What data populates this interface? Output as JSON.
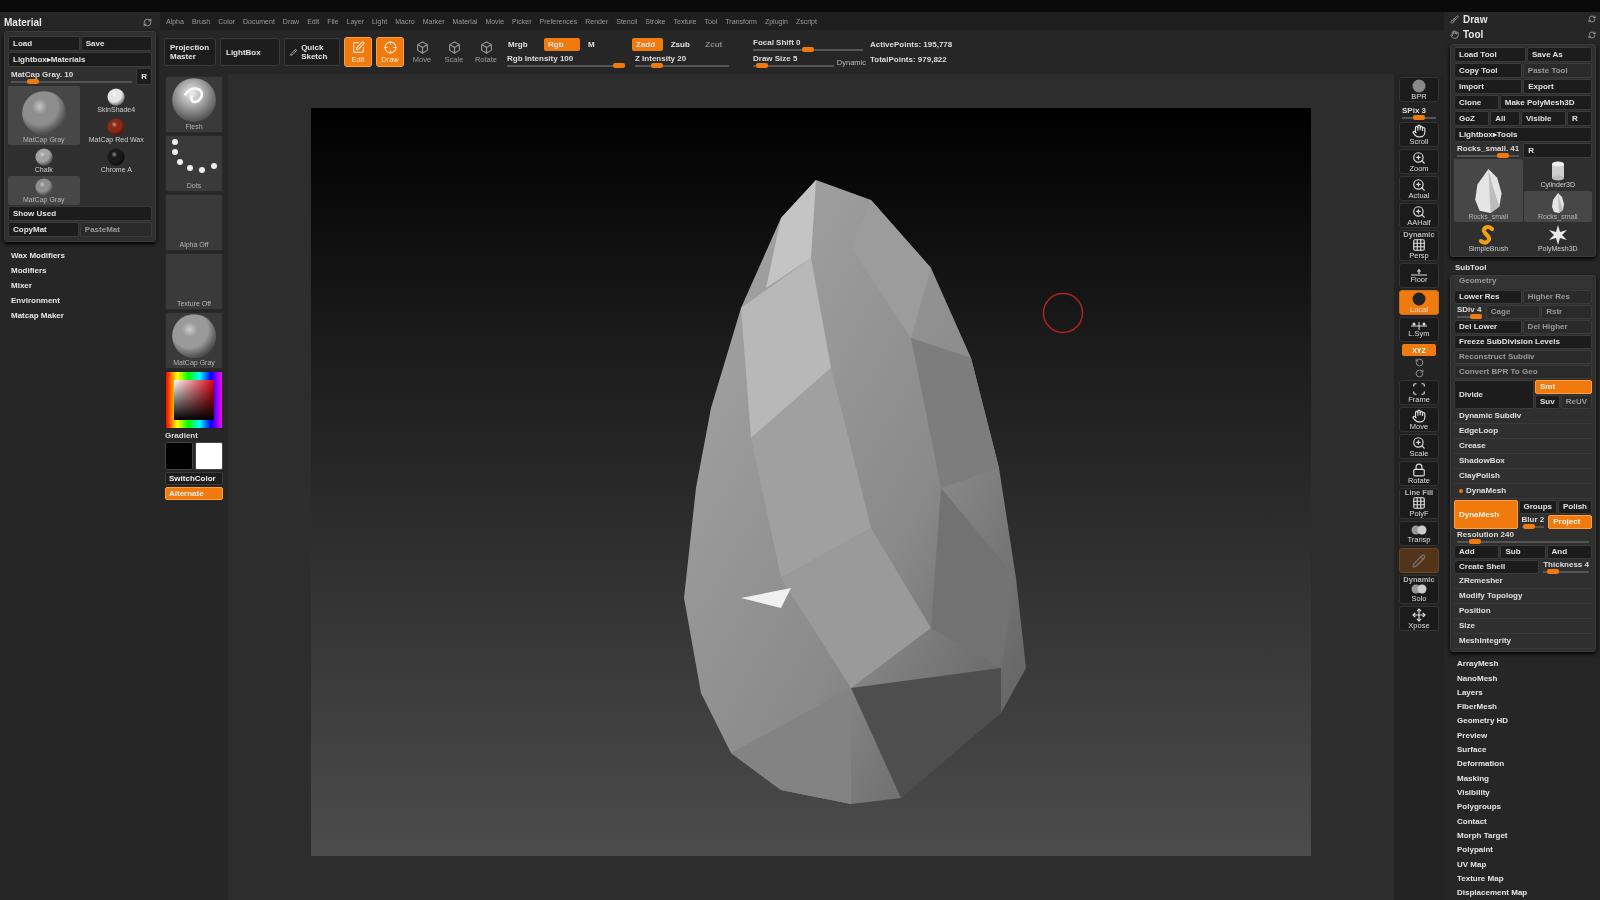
{
  "material_palette": {
    "title": "Material",
    "file_buttons": [
      "Load",
      "Save"
    ],
    "lightbox": "Lightbox▸Materials",
    "slider": {
      "label": "MatCap Gray. 10",
      "level": 0.15
    },
    "reset": "R",
    "materials": [
      {
        "name": "SkinShade4",
        "color": "#e6e6e6",
        "selected": false
      },
      {
        "name": "MatCap Gray",
        "color": "#8e8e8e",
        "selected": true
      },
      {
        "name": "MatCap Red Wax",
        "color": "#8c2a16",
        "selected": false
      },
      {
        "name": "Chalk",
        "color": "#a2a2a2",
        "selected": false
      },
      {
        "name": "Chrome A",
        "color": "#1a1a1a",
        "selected": false
      },
      {
        "name": "MatCap Gray",
        "color": "#8e8e8e",
        "selected": true
      }
    ],
    "show_used": "Show Used",
    "copy": "CopyMat",
    "paste": {
      "label": "PasteMat",
      "disabled": true
    },
    "subpalettes": [
      "Wax Modifiers",
      "Modifiers",
      "Mixer",
      "Environment",
      "Matcap Maker"
    ]
  },
  "menu": [
    "Alpha",
    "Brush",
    "Color",
    "Document",
    "Draw",
    "Edit",
    "File",
    "Layer",
    "Light",
    "Macro",
    "Marker",
    "Material",
    "Movie",
    "Picker",
    "Preferences",
    "Render",
    "Stencil",
    "Stroke",
    "Texture",
    "Tool",
    "Transform",
    "Zplugin",
    "Zscript"
  ],
  "toolbar": {
    "projection_master": "Projection Master",
    "lightbox": "LightBox",
    "quick_sketch": "Quick Sketch",
    "modes": [
      {
        "kind": "edit",
        "label": "Edit",
        "on": true
      },
      {
        "kind": "draw",
        "label": "Draw",
        "on": true
      },
      {
        "kind": "move",
        "label": "Move",
        "on": false
      },
      {
        "kind": "scale",
        "label": "Scale",
        "on": false
      },
      {
        "kind": "rotate",
        "label": "Rotate",
        "on": false
      }
    ],
    "color_modes": [
      {
        "label": "Mrgb",
        "on": false
      },
      {
        "label": "Rgb",
        "on": true
      },
      {
        "label": "M",
        "on": false
      }
    ],
    "rgb_intensity": {
      "label": "Rgb Intensity 100",
      "level": 1
    },
    "depth_modes": [
      {
        "label": "Zadd",
        "on": true,
        "disabled": false
      },
      {
        "label": "Zsub",
        "on": false,
        "disabled": false
      },
      {
        "label": "Zcut",
        "on": false,
        "disabled": true
      }
    ],
    "z_intensity": {
      "label": "Z Intensity 20",
      "level": 0.2
    },
    "focal_shift": {
      "label": "Focal Shift 0",
      "level": 0.5
    },
    "draw_size": {
      "label": "Draw Size 5",
      "level": 0.05
    },
    "dynamic": "Dynamic",
    "active_points": "ActivePoints: 195,778",
    "total_points": "TotalPoints: 979,822"
  },
  "left_shelf": [
    {
      "kind": "brush",
      "label": "Flesh"
    },
    {
      "kind": "stroke",
      "label": "Dots"
    },
    {
      "kind": "alpha",
      "label": "Alpha Off"
    },
    {
      "kind": "texture",
      "label": "Texture Off"
    },
    {
      "kind": "material",
      "label": "MatCap Gray"
    },
    {
      "kind": "picker"
    },
    {
      "kind": "label",
      "label": "Gradient"
    },
    {
      "kind": "swatches",
      "colors": [
        {
          "color": "#000000"
        },
        {
          "color": "#ffffff"
        }
      ]
    },
    {
      "kind": "button",
      "label": "SwitchColor",
      "on": false
    },
    {
      "kind": "button",
      "label": "Alternate",
      "on": true
    }
  ],
  "right_shelf": [
    {
      "kind": "sphere",
      "label": "BPR",
      "on": false,
      "disabled": false
    },
    {
      "kind": "slider",
      "label": "SPix 3",
      "level": 0.5
    },
    {
      "kind": "hand",
      "label": "Scroll",
      "on": false,
      "disabled": false
    },
    {
      "kind": "magnifier",
      "label": "Zoom",
      "on": false,
      "disabled": false
    },
    {
      "kind": "magnifier",
      "label": "Actual",
      "on": false,
      "disabled": false
    },
    {
      "kind": "magnifier",
      "label": "AAHalf",
      "on": false,
      "disabled": false
    },
    {
      "kind": "grid",
      "caption": "Dynamic",
      "label": "Persp",
      "on": false,
      "disabled": false
    },
    {
      "kind": "floor",
      "label": "Floor",
      "on": false,
      "disabled": false
    },
    {
      "kind": "local",
      "label": "Local",
      "on": true,
      "disabled": false
    },
    {
      "kind": "symmetry",
      "label": "L.Sym",
      "on": false,
      "disabled": false
    },
    {
      "kind": "toggle",
      "label": "XYZ",
      "on": true
    },
    {
      "kind": "rotations"
    },
    {
      "kind": "frame",
      "label": "Frame",
      "on": false,
      "disabled": false
    },
    {
      "kind": "hand",
      "label": "Move",
      "on": false,
      "disabled": false
    },
    {
      "kind": "magnifier",
      "label": "Scale",
      "on": false,
      "disabled": false
    },
    {
      "kind": "lock",
      "label": "Rotate",
      "on": false,
      "disabled": false
    },
    {
      "kind": "grid",
      "caption": "Line Fill",
      "label": "PolyF",
      "on": false,
      "disabled": false
    },
    {
      "kind": "spheres",
      "label": "Transp",
      "on": false,
      "disabled": false
    },
    {
      "kind": "ghost",
      "on": true,
      "disabled": true
    },
    {
      "kind": "spheres",
      "caption": "Dynamic",
      "label": "Solo",
      "on": false,
      "disabled": false
    },
    {
      "kind": "arrows",
      "label": "Xpose",
      "on": false,
      "disabled": false
    }
  ],
  "right_panel": {
    "draw_title": "Draw",
    "tool_title": "Tool",
    "tool_rows": [
      [
        {
          "kind": "button",
          "label": "Load Tool",
          "on": false,
          "disabled": false
        },
        {
          "kind": "button",
          "label": "Save As",
          "on": false,
          "disabled": false
        }
      ],
      [
        {
          "kind": "button",
          "label": "Copy Tool",
          "on": false,
          "disabled": false
        },
        {
          "kind": "button",
          "label": "Paste Tool",
          "on": false,
          "disabled": true
        }
      ],
      [
        {
          "kind": "button",
          "label": "Import",
          "on": false,
          "disabled": false
        },
        {
          "kind": "button",
          "label": "Export",
          "on": false,
          "disabled": false
        }
      ],
      [
        {
          "kind": "button",
          "label": "Clone",
          "on": false,
          "disabled": false
        },
        {
          "kind": "button",
          "label": "Make PolyMesh3D",
          "on": false,
          "disabled": false
        }
      ],
      [
        {
          "kind": "button",
          "label": "GoZ",
          "on": false,
          "disabled": false
        },
        {
          "kind": "button",
          "label": "All",
          "on": false,
          "disabled": false
        },
        {
          "kind": "button",
          "label": "Visible",
          "on": false,
          "disabled": false
        },
        {
          "kind": "button",
          "label": "R",
          "on": false,
          "disabled": false
        }
      ],
      [
        {
          "kind": "button",
          "label": "Lightbox▸Tools",
          "on": false,
          "disabled": false
        }
      ],
      [
        {
          "kind": "slider",
          "label": "Rocks_small. 41",
          "level": 0.8
        },
        {
          "kind": "button",
          "label": "R",
          "on": false,
          "disabled": false
        }
      ]
    ],
    "tools": [
      {
        "kind": "cylinder",
        "name": "Cylinder3D",
        "selected": false
      },
      {
        "kind": "rock",
        "name": "Rocks_small",
        "selected": true
      },
      {
        "kind": "rock",
        "name": "Rocks_small",
        "selected": true
      },
      {
        "kind": "brush",
        "name": "SimpleBrush",
        "selected": false
      },
      {
        "kind": "star",
        "name": "PolyMesh3D",
        "selected": false
      }
    ],
    "subtool": "SubTool",
    "geometry": {
      "title": "Geometry",
      "rows": [
        {
          "kind": "buttons",
          "cells": [
            {
              "kind": "button",
              "label": "Lower Res",
              "on": false,
              "disabled": false
            },
            {
              "kind": "button",
              "label": "Higher Res",
              "on": false,
              "disabled": true
            }
          ]
        },
        {
          "kind": "buttons",
          "cells": [
            {
              "kind": "slider",
              "label": "SDiv 4",
              "level": 1
            },
            {
              "kind": "button",
              "label": "Cage",
              "on": false,
              "disabled": true
            },
            {
              "kind": "button",
              "label": "Rstr",
              "on": false,
              "disabled": true
            }
          ]
        },
        {
          "kind": "buttons",
          "cells": [
            {
              "kind": "button",
              "label": "Del Lower",
              "on": false,
              "disabled": false
            },
            {
              "kind": "button",
              "label": "Del Higher",
              "on": false,
              "disabled": true
            }
          ]
        },
        {
          "kind": "buttons",
          "cells": [
            {
              "kind": "button",
              "label": "Freeze SubDivision Levels",
              "on": false,
              "disabled": false
            }
          ]
        },
        {
          "kind": "buttons",
          "cells": [
            {
              "kind": "button",
              "label": "Reconstruct Subdiv",
              "on": false,
              "disabled": true
            }
          ]
        },
        {
          "kind": "buttons",
          "cells": [
            {
              "kind": "button",
              "label": "Convert BPR To Geo",
              "on": false,
              "disabled": true
            }
          ]
        },
        {
          "kind": "split",
          "main": {
            "kind": "button",
            "label": "Divide",
            "on": false,
            "disabled": false
          },
          "side": [
            [
              {
                "kind": "button",
                "label": "Smt",
                "on": true,
                "disabled": false
              }
            ],
            [
              {
                "kind": "button",
                "label": "Suv",
                "on": false,
                "disabled": false
              },
              {
                "kind": "button",
                "label": "ReUV",
                "on": false,
                "disabled": true
              }
            ]
          ]
        },
        {
          "kind": "section",
          "label": "Dynamic Subdiv",
          "marked": false
        },
        {
          "kind": "section",
          "label": "EdgeLoop",
          "marked": false
        },
        {
          "kind": "section",
          "label": "Crease",
          "marked": false
        },
        {
          "kind": "section",
          "label": "ShadowBox",
          "marked": false
        },
        {
          "kind": "section",
          "label": "ClayPolish",
          "marked": false
        },
        {
          "kind": "section",
          "label": "DynaMesh",
          "marked": true
        },
        {
          "kind": "split",
          "main": {
            "kind": "button",
            "label": "DynaMesh",
            "on": true,
            "disabled": false
          },
          "side": [
            [
              {
                "kind": "button",
                "label": "Groups",
                "on": false,
                "disabled": false
              },
              {
                "kind": "button",
                "label": "Polish",
                "on": false,
                "disabled": false
              }
            ],
            [
              {
                "kind": "slider",
                "label": "Blur 2",
                "level": 0.1
              },
              {
                "kind": "button",
                "label": "Project",
                "on": true,
                "disabled": false
              }
            ]
          ]
        },
        {
          "kind": "buttons",
          "cells": [
            {
              "kind": "slider",
              "label": "Resolution 240",
              "level": 0.1
            }
          ]
        },
        {
          "kind": "buttons",
          "cells": [
            {
              "kind": "button",
              "label": "Add",
              "on": false,
              "disabled": false
            },
            {
              "kind": "button",
              "label": "Sub",
              "on": false,
              "disabled": false
            },
            {
              "kind": "button",
              "label": "And",
              "on": false,
              "disabled": false
            }
          ]
        },
        {
          "kind": "buttons",
          "cells": [
            {
              "kind": "button",
              "label": "Create Shell",
              "on": false,
              "disabled": false
            },
            {
              "kind": "slider",
              "label": "Thickness 4",
              "level": 0.1
            }
          ]
        },
        {
          "kind": "section",
          "label": "ZRemesher",
          "marked": false
        },
        {
          "kind": "section",
          "label": "Modify Topology",
          "marked": false
        },
        {
          "kind": "section",
          "label": "Position",
          "marked": false
        },
        {
          "kind": "section",
          "label": "Size",
          "marked": false
        },
        {
          "kind": "section",
          "label": "MeshIntegrity",
          "marked": false
        }
      ]
    },
    "subpalettes": [
      "ArrayMesh",
      "NanoMesh",
      "Layers",
      "FiberMesh",
      "Geometry HD",
      "Preview",
      "Surface",
      "Deformation",
      "Masking",
      "Visibility",
      "Polygroups",
      "Contact",
      "Morph Target",
      "Polypaint",
      "UV Map",
      "Texture Map",
      "Displacement Map"
    ]
  }
}
